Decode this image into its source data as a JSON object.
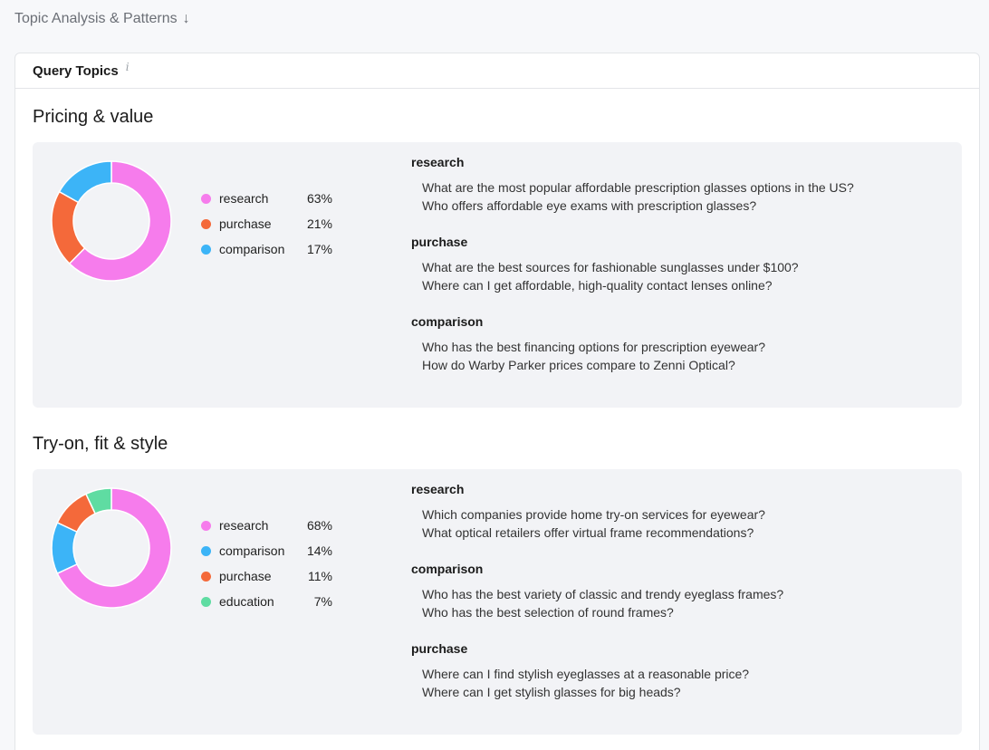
{
  "header": {
    "title": "Topic Analysis & Patterns",
    "arrow": "↓"
  },
  "card": {
    "title": "Query Topics",
    "info": "i"
  },
  "colors": {
    "research": "#f67cec",
    "purchase": "#f4693a",
    "comparison": "#3cb4f7",
    "education": "#5fdca2"
  },
  "sections": [
    {
      "title": "Pricing & value",
      "legend": [
        {
          "label": "research",
          "pct": "63%",
          "value": 63,
          "color": "#f67cec"
        },
        {
          "label": "purchase",
          "pct": "21%",
          "value": 21,
          "color": "#f4693a"
        },
        {
          "label": "comparison",
          "pct": "17%",
          "value": 17,
          "color": "#3cb4f7"
        }
      ],
      "groups": [
        {
          "title": "research",
          "queries": [
            "What are the most popular affordable prescription glasses options in the US?",
            "Who offers affordable eye exams with prescription glasses?"
          ]
        },
        {
          "title": "purchase",
          "queries": [
            "What are the best sources for fashionable sunglasses under $100?",
            "Where can I get affordable, high-quality contact lenses online?"
          ]
        },
        {
          "title": "comparison",
          "queries": [
            "Who has the best financing options for prescription eyewear?",
            "How do Warby Parker prices compare to Zenni Optical?"
          ]
        }
      ]
    },
    {
      "title": "Try-on, fit & style",
      "legend": [
        {
          "label": "research",
          "pct": "68%",
          "value": 68,
          "color": "#f67cec"
        },
        {
          "label": "comparison",
          "pct": "14%",
          "value": 14,
          "color": "#3cb4f7"
        },
        {
          "label": "purchase",
          "pct": "11%",
          "value": 11,
          "color": "#f4693a"
        },
        {
          "label": "education",
          "pct": "7%",
          "value": 7,
          "color": "#5fdca2"
        }
      ],
      "groups": [
        {
          "title": "research",
          "queries": [
            "Which companies provide home try-on services for eyewear?",
            "What optical retailers offer virtual frame recommendations?"
          ]
        },
        {
          "title": "comparison",
          "queries": [
            "Who has the best variety of classic and trendy eyeglass frames?",
            "Who has the best selection of round frames?"
          ]
        },
        {
          "title": "purchase",
          "queries": [
            "Where can I find stylish eyeglasses at a reasonable price?",
            "Where can I get stylish glasses for big heads?"
          ]
        }
      ]
    }
  ]
}
